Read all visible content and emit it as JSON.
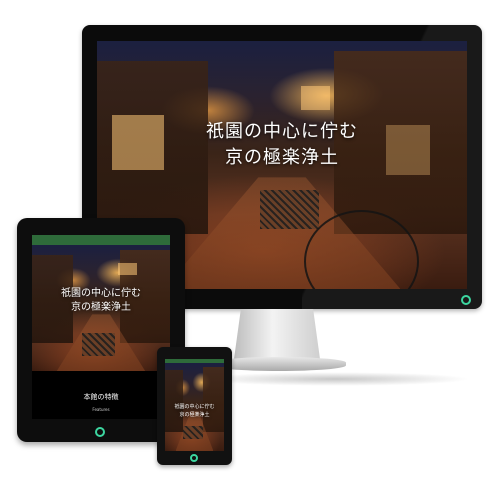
{
  "hero": {
    "line1": "祇園の中心に佇む",
    "line2": "京の極楽浄土"
  },
  "tablet": {
    "features_title": "本館の特徴",
    "features_sub": "Features"
  },
  "colors": {
    "tablet_header": "#2e6b3a",
    "power_led": "#3cd6a0"
  },
  "icons": [
    "power-icon"
  ]
}
